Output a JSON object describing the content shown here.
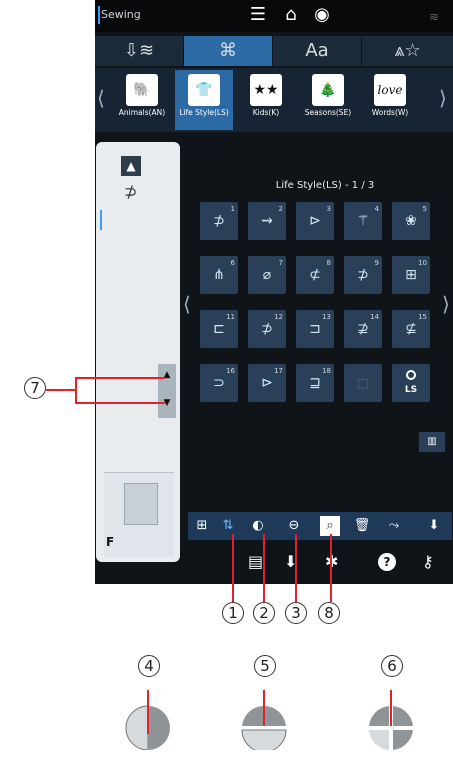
{
  "header": {
    "mode_label": "Sewing"
  },
  "category_tabs": [
    "⇩≋",
    "⌘",
    "Aa",
    "⩓☆"
  ],
  "styles": [
    {
      "label": "Animals(AN)",
      "icon": "🐘"
    },
    {
      "label": "Life Style(LS)",
      "icon": "👕"
    },
    {
      "label": "Kids(K)",
      "icon": "★★"
    },
    {
      "label": "Seasons(SE)",
      "icon": "🎄"
    },
    {
      "label": "Words(W)",
      "icon": "love"
    }
  ],
  "grid": {
    "title": "Life Style(LS) - 1 / 3",
    "nums": [
      "1",
      "2",
      "3",
      "4",
      "5",
      "6",
      "7",
      "8",
      "9",
      "10",
      "11",
      "12",
      "13",
      "14",
      "15",
      "16",
      "17",
      "18"
    ],
    "ls_label": "LS"
  },
  "left_panel": {
    "foot_label": "F"
  },
  "callouts": {
    "c1": "1",
    "c2": "2",
    "c3": "3",
    "c4": "4",
    "c5": "5",
    "c6": "6",
    "c7": "7",
    "c8": "8"
  },
  "colors": {
    "accent": "#2b6aa5",
    "callout": "#e3212b"
  }
}
